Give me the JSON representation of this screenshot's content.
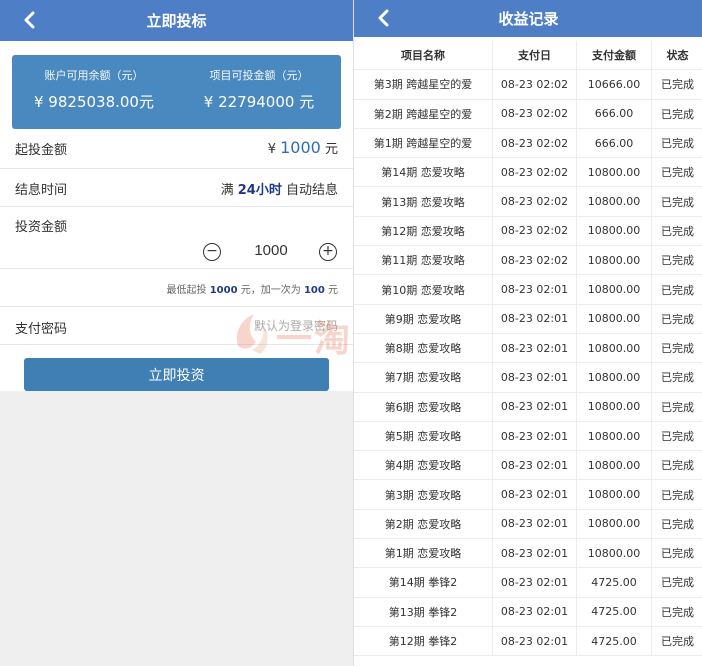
{
  "left": {
    "header": {
      "title": "立即投标",
      "back_icon": "chevron-left-icon"
    },
    "summary": {
      "available_label": "账户可用余额（元）",
      "available_value": "¥ 9825038.00元",
      "investable_label": "项目可投金额（元）",
      "investable_value": "¥ 22794000 元"
    },
    "min_invest": {
      "label": "起投金额",
      "currency": "¥",
      "amount": "1000",
      "unit": "元"
    },
    "interest_time": {
      "label": "结息时间",
      "prefix": "满",
      "hours": "24小时",
      "suffix": "自动结息"
    },
    "invest_amount": {
      "label": "投资金额",
      "minus": "−",
      "value": "1000",
      "plus": "+"
    },
    "hint": {
      "text1": "最低起投",
      "min": "1000",
      "text2": "元，加一次为",
      "step": "100",
      "text3": "元"
    },
    "pay_password": {
      "label": "支付密码",
      "placeholder": "默认为登录密码"
    },
    "submit_label": "立即投资",
    "watermark_text": "一淘源码"
  },
  "right": {
    "header": {
      "title": "收益记录",
      "back_icon": "chevron-left-icon"
    },
    "columns": [
      "项目名称",
      "支付日",
      "支付金额",
      "状态"
    ],
    "rows": [
      [
        "第3期 跨越星空的爱",
        "08-23 02:02",
        "10666.00",
        "已完成"
      ],
      [
        "第2期 跨越星空的爱",
        "08-23 02:02",
        "666.00",
        "已完成"
      ],
      [
        "第1期 跨越星空的爱",
        "08-23 02:02",
        "666.00",
        "已完成"
      ],
      [
        "第14期 恋爱攻略",
        "08-23 02:02",
        "10800.00",
        "已完成"
      ],
      [
        "第13期 恋爱攻略",
        "08-23 02:02",
        "10800.00",
        "已完成"
      ],
      [
        "第12期 恋爱攻略",
        "08-23 02:02",
        "10800.00",
        "已完成"
      ],
      [
        "第11期 恋爱攻略",
        "08-23 02:02",
        "10800.00",
        "已完成"
      ],
      [
        "第10期 恋爱攻略",
        "08-23 02:01",
        "10800.00",
        "已完成"
      ],
      [
        "第9期 恋爱攻略",
        "08-23 02:01",
        "10800.00",
        "已完成"
      ],
      [
        "第8期 恋爱攻略",
        "08-23 02:01",
        "10800.00",
        "已完成"
      ],
      [
        "第7期 恋爱攻略",
        "08-23 02:01",
        "10800.00",
        "已完成"
      ],
      [
        "第6期 恋爱攻略",
        "08-23 02:01",
        "10800.00",
        "已完成"
      ],
      [
        "第5期 恋爱攻略",
        "08-23 02:01",
        "10800.00",
        "已完成"
      ],
      [
        "第4期 恋爱攻略",
        "08-23 02:01",
        "10800.00",
        "已完成"
      ],
      [
        "第3期 恋爱攻略",
        "08-23 02:01",
        "10800.00",
        "已完成"
      ],
      [
        "第2期 恋爱攻略",
        "08-23 02:01",
        "10800.00",
        "已完成"
      ],
      [
        "第1期 恋爱攻略",
        "08-23 02:01",
        "10800.00",
        "已完成"
      ],
      [
        "第14期 拳锋2",
        "08-23 02:01",
        "4725.00",
        "已完成"
      ],
      [
        "第13期 拳锋2",
        "08-23 02:01",
        "4725.00",
        "已完成"
      ],
      [
        "第12期 拳锋2",
        "08-23 02:01",
        "4725.00",
        "已完成"
      ]
    ]
  },
  "colors": {
    "header_bg": "#4e7ec5",
    "card_bg": "#4989c0",
    "button_bg": "#3f7fb4",
    "accent_blue": "#2f6db5",
    "accent_dark": "#1f3a8a",
    "watermark": "#e96b4a"
  }
}
